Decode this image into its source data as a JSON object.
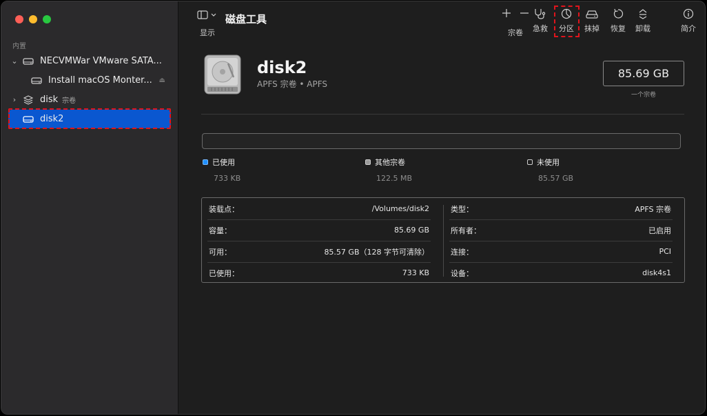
{
  "sidebar": {
    "section": "内置",
    "items": [
      {
        "label": "NECVMWar VMware SATA...",
        "sub": ""
      },
      {
        "label": "Install macOS Monter...",
        "sub": ""
      },
      {
        "label": "disk",
        "sub": "宗卷"
      },
      {
        "label": "disk2",
        "sub": ""
      }
    ]
  },
  "toolbar": {
    "view_label": "显示",
    "title": "磁盘工具",
    "volume_label": "宗卷",
    "firstaid_label": "急救",
    "partition_label": "分区",
    "erase_label": "抹掉",
    "restore_label": "恢复",
    "unmount_label": "卸载",
    "info_label": "简介"
  },
  "disk": {
    "name": "disk2",
    "subtitle": "APFS 宗卷 • APFS",
    "size": "85.69 GB",
    "size_note": "一个宗卷"
  },
  "usage": {
    "used_label": "已使用",
    "used_value": "733 KB",
    "used_color": "#1f8fff",
    "other_label": "其他宗卷",
    "other_value": "122.5 MB",
    "other_color": "#9a9a9a",
    "free_label": "未使用",
    "free_value": "85.57 GB"
  },
  "info": {
    "left": [
      {
        "k": "装载点：",
        "v": "/Volumes/disk2"
      },
      {
        "k": "容量：",
        "v": "85.69 GB"
      },
      {
        "k": "可用：",
        "v": "85.57 GB（128 字节可清除）"
      },
      {
        "k": "已使用：",
        "v": "733 KB"
      }
    ],
    "right": [
      {
        "k": "类型：",
        "v": "APFS 宗卷"
      },
      {
        "k": "所有者：",
        "v": "已启用"
      },
      {
        "k": "连接：",
        "v": "PCI"
      },
      {
        "k": "设备：",
        "v": "disk4s1"
      }
    ]
  }
}
